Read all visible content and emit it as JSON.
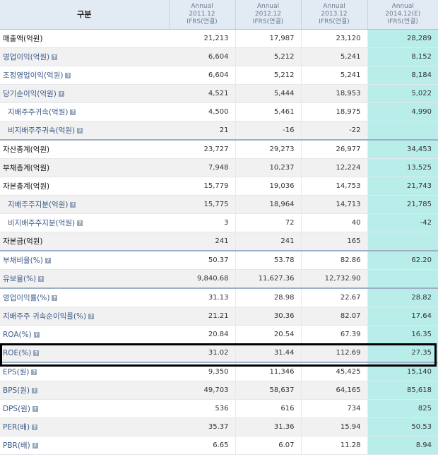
{
  "header": {
    "label": "구분",
    "columns": [
      {
        "period": "Annual",
        "date": "2011.12",
        "basis": "IFRS(연결)"
      },
      {
        "period": "Annual",
        "date": "2012.12",
        "basis": "IFRS(연결)"
      },
      {
        "period": "Annual",
        "date": "2013.12",
        "basis": "IFRS(연결)"
      },
      {
        "period": "Annual",
        "date": "2014.12(E)",
        "basis": "IFRS(연결)"
      }
    ]
  },
  "help_glyph": "?",
  "rows": [
    {
      "label": "매출액(억원)",
      "style": "dark",
      "help": false,
      "indent": false,
      "values": [
        "21,213",
        "17,987",
        "23,120",
        "28,289"
      ]
    },
    {
      "label": "영업이익(억원)",
      "style": "link",
      "help": true,
      "indent": false,
      "values": [
        "6,604",
        "5,212",
        "5,241",
        "8,152"
      ]
    },
    {
      "label": "조정영업이익(억원)",
      "style": "link",
      "help": true,
      "indent": false,
      "values": [
        "6,604",
        "5,212",
        "5,241",
        "8,184"
      ]
    },
    {
      "label": "당기순이익(억원)",
      "style": "link",
      "help": true,
      "indent": false,
      "values": [
        "4,521",
        "5,444",
        "18,953",
        "5,022"
      ]
    },
    {
      "label": "지배주주귀속(억원)",
      "style": "link",
      "help": true,
      "indent": true,
      "values": [
        "4,500",
        "5,461",
        "18,975",
        "4,990"
      ]
    },
    {
      "label": "비지배주주귀속(억원)",
      "style": "link",
      "help": true,
      "indent": true,
      "values": [
        "21",
        "-16",
        "-22",
        ""
      ]
    },
    {
      "label": "자산총계(억원)",
      "style": "dark",
      "help": false,
      "indent": false,
      "values": [
        "23,727",
        "29,273",
        "26,977",
        "34,453"
      ]
    },
    {
      "label": "부채총계(억원)",
      "style": "dark",
      "help": false,
      "indent": false,
      "values": [
        "7,948",
        "10,237",
        "12,224",
        "13,525"
      ]
    },
    {
      "label": "자본총계(억원)",
      "style": "dark",
      "help": false,
      "indent": false,
      "values": [
        "15,779",
        "19,036",
        "14,753",
        "21,743"
      ]
    },
    {
      "label": "지배주주지분(억원)",
      "style": "link",
      "help": true,
      "indent": true,
      "values": [
        "15,775",
        "18,964",
        "14,713",
        "21,785"
      ]
    },
    {
      "label": "비지배주주지분(억원)",
      "style": "link",
      "help": true,
      "indent": true,
      "values": [
        "3",
        "72",
        "40",
        "-42"
      ]
    },
    {
      "label": "자본금(억원)",
      "style": "dark",
      "help": false,
      "indent": false,
      "values": [
        "241",
        "241",
        "165",
        ""
      ]
    },
    {
      "label": "부채비율(%)",
      "style": "link",
      "help": true,
      "indent": false,
      "values": [
        "50.37",
        "53.78",
        "82.86",
        "62.20"
      ]
    },
    {
      "label": "유보율(%)",
      "style": "link",
      "help": true,
      "indent": false,
      "values": [
        "9,840.68",
        "11,627.36",
        "12,732.90",
        ""
      ]
    },
    {
      "label": "영업이익률(%)",
      "style": "link",
      "help": true,
      "indent": false,
      "values": [
        "31.13",
        "28.98",
        "22.67",
        "28.82"
      ]
    },
    {
      "label": "지배주주 귀속순이익률(%)",
      "style": "link",
      "help": true,
      "indent": false,
      "values": [
        "21.21",
        "30.36",
        "82.07",
        "17.64"
      ]
    },
    {
      "label": "ROA(%)",
      "style": "link",
      "help": true,
      "indent": false,
      "values": [
        "20.84",
        "20.54",
        "67.39",
        "16.35"
      ]
    },
    {
      "label": "ROE(%)",
      "style": "link",
      "help": true,
      "indent": false,
      "values": [
        "31.02",
        "31.44",
        "112.69",
        "27.35"
      ]
    },
    {
      "label": "EPS(원)",
      "style": "link",
      "help": true,
      "indent": false,
      "values": [
        "9,350",
        "11,346",
        "45,425",
        "15,140"
      ]
    },
    {
      "label": "BPS(원)",
      "style": "link",
      "help": true,
      "indent": false,
      "values": [
        "49,703",
        "58,637",
        "64,165",
        "85,618"
      ]
    },
    {
      "label": "DPS(원)",
      "style": "link",
      "help": true,
      "indent": false,
      "values": [
        "536",
        "616",
        "734",
        "825"
      ]
    },
    {
      "label": "PER(배)",
      "style": "link",
      "help": true,
      "indent": false,
      "values": [
        "35.37",
        "31.36",
        "15.94",
        "50.53"
      ]
    },
    {
      "label": "PBR(배)",
      "style": "link",
      "help": true,
      "indent": false,
      "values": [
        "6.65",
        "6.07",
        "11.28",
        "8.94"
      ]
    }
  ],
  "colors": {
    "header_bg": "#e2eaf4",
    "estimate_bg": "#b9ede9",
    "negative": "#e23030",
    "link_label": "#3a5a8a"
  }
}
